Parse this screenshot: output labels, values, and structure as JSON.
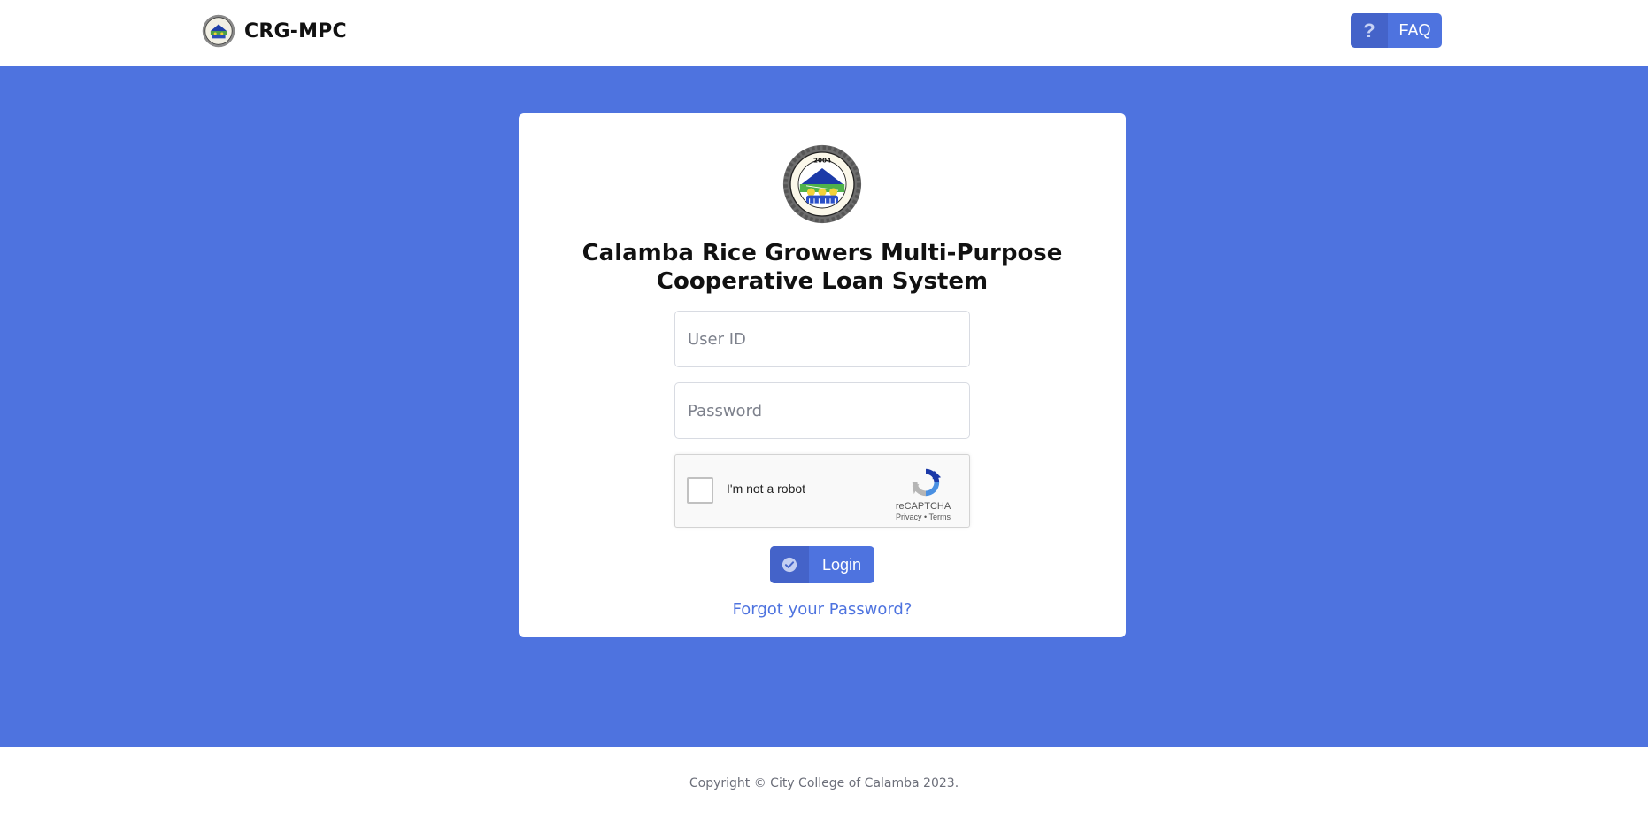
{
  "header": {
    "brand_name": "CRG-MPC",
    "faq_label": "FAQ",
    "faq_icon": "question-mark-icon"
  },
  "login": {
    "title_line1": "Calamba Rice Growers Multi-Purpose",
    "title_line2": "Cooperative Loan System",
    "user_id_placeholder": "User ID",
    "user_id_value": "",
    "password_placeholder": "Password",
    "password_value": "",
    "recaptcha": {
      "label": "I'm not a robot",
      "brand": "reCAPTCHA",
      "privacy": "Privacy",
      "separator": " • ",
      "terms": "Terms"
    },
    "login_label": "Login",
    "login_icon": "check-circle-icon",
    "forgot_password": "Forgot your Password?"
  },
  "logo_text": {
    "year": "2004"
  },
  "footer": {
    "copyright": "Copyright © City College of Calamba 2023."
  },
  "colors": {
    "primary": "#4e73df",
    "primary_dark": "#4463c9",
    "background_hero": "#4e73df",
    "link": "#4e73df"
  }
}
